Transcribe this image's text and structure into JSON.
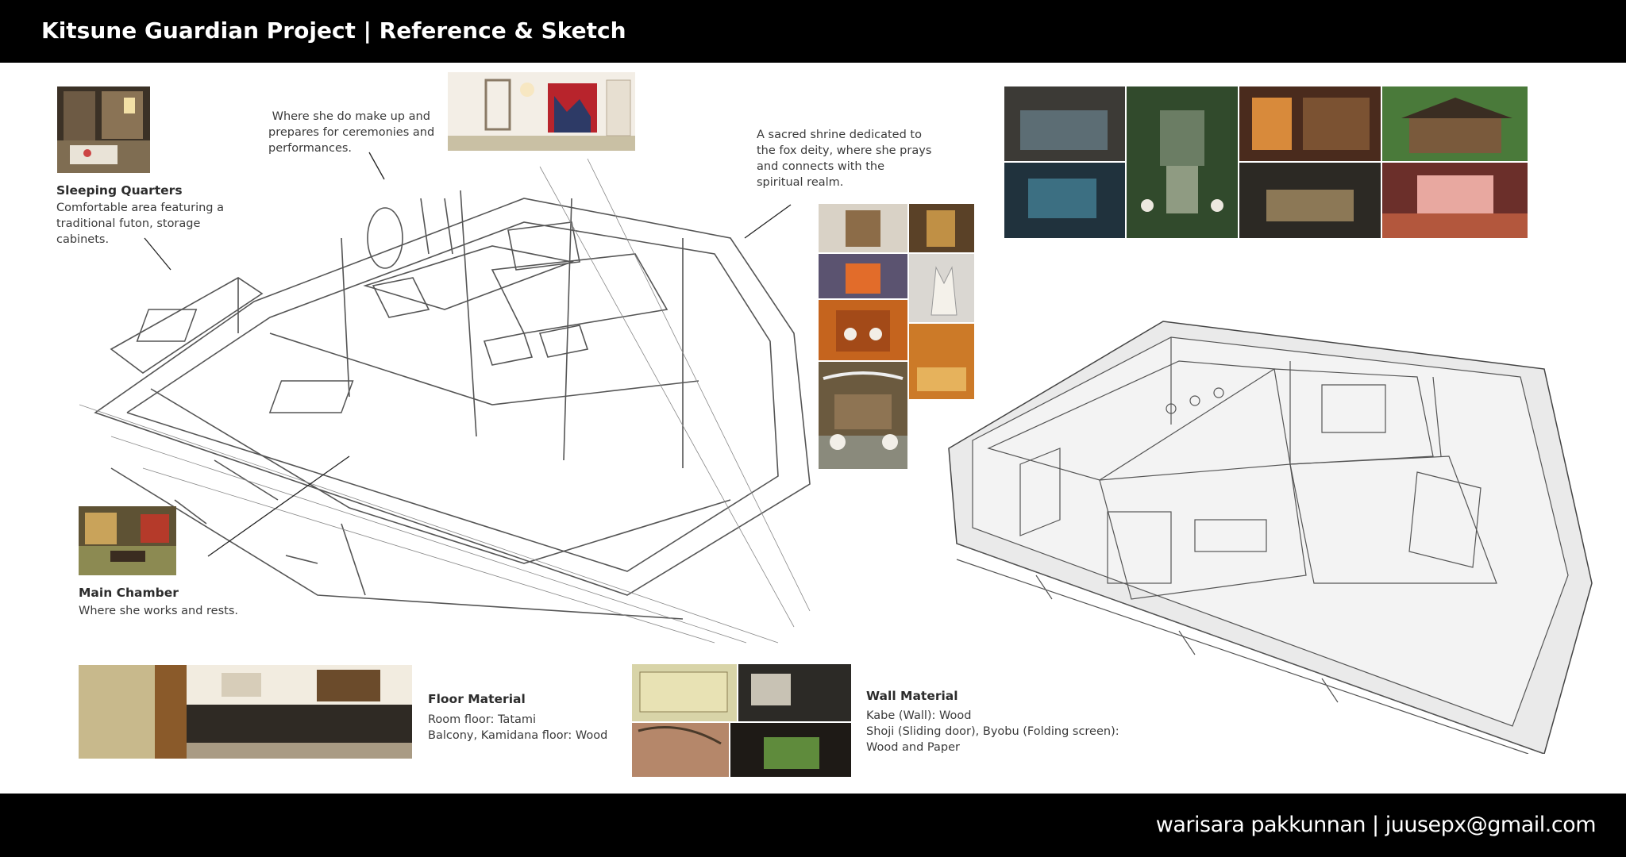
{
  "header": {
    "title": "Kitsune Guardian Project | Reference & Sketch"
  },
  "footer": {
    "credit": "warisara pakkunnan | juusepx@gmail.com"
  },
  "annotations": {
    "sleeping": {
      "heading": "Sleeping Quarters",
      "lines": [
        "Comfortable area featuring a",
        "traditional futon, storage",
        "cabinets."
      ]
    },
    "makeup": {
      "lines": [
        " Where she do make up and",
        "prepares for ceremonies and",
        "performances."
      ]
    },
    "shrine": {
      "lines": [
        "A sacred shrine dedicated to",
        "the fox deity, where she prays",
        "and connects with the",
        "spiritual realm."
      ]
    },
    "main_chamber": {
      "heading": "Main Chamber",
      "lines": [
        "Where she works and rests."
      ]
    },
    "floor": {
      "heading": "Floor Material",
      "lines": [
        "Room floor: Tatami",
        "Balcony, Kamidana floor: Wood"
      ]
    },
    "wall": {
      "heading": "Wall Material",
      "lines": [
        "Kabe (Wall): Wood",
        "Shoji (Sliding door), Byobu (Folding screen):",
        "Wood and Paper"
      ]
    }
  },
  "colors": {
    "bar": "#000000",
    "page": "#ffffff",
    "sketch_line": "#444444",
    "render_fill": "#e9e9e9"
  }
}
